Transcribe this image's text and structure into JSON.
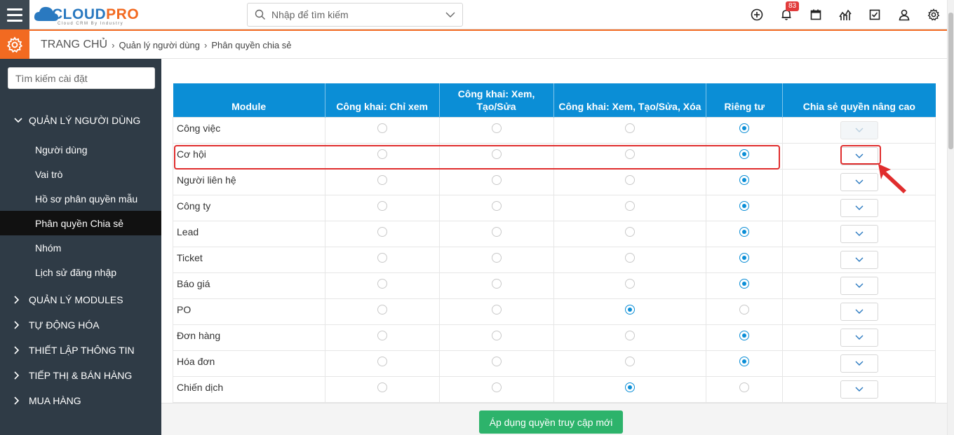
{
  "header": {
    "logo": {
      "brand_a": "CLOUD",
      "brand_b": "PRO",
      "tagline": "Cloud CRM By Industry"
    },
    "search": {
      "placeholder": "Nhập để tìm kiếm"
    },
    "notifications": {
      "count": "83"
    },
    "icons": [
      "add-circle-icon",
      "bell-icon",
      "calendar-icon",
      "chart-icon",
      "checkbox-icon",
      "user-icon",
      "gear-icon"
    ]
  },
  "breadcrumb": {
    "home": "TRANG CHỦ",
    "items": [
      "Quản lý người dùng",
      "Phân quyền chia sẻ"
    ]
  },
  "sidebar": {
    "search_placeholder": "Tìm kiếm cài đặt",
    "groups": [
      {
        "label": "QUẢN LÝ NGƯỜI DÙNG",
        "expanded": true
      },
      {
        "label": "QUẢN LÝ MODULES",
        "expanded": false
      },
      {
        "label": "TỰ ĐỘNG HÓA",
        "expanded": false
      },
      {
        "label": "THIẾT LẬP THÔNG TIN",
        "expanded": false
      },
      {
        "label": "TIẾP THỊ & BÁN HÀNG",
        "expanded": false
      },
      {
        "label": "MUA HÀNG",
        "expanded": false
      }
    ],
    "items": [
      {
        "label": "Người dùng",
        "active": false
      },
      {
        "label": "Vai trò",
        "active": false
      },
      {
        "label": "Hồ sơ phân quyền mẫu",
        "active": false
      },
      {
        "label": "Phân quyền Chia sẻ",
        "active": true
      },
      {
        "label": "Nhóm",
        "active": false
      },
      {
        "label": "Lịch sử đăng nhập",
        "active": false
      }
    ]
  },
  "table": {
    "columns": [
      "Module",
      "Công khai: Chỉ xem",
      "Công khai: Xem, Tạo/Sửa",
      "Công khai: Xem, Tạo/Sửa, Xóa",
      "Riêng tư",
      "Chia sẻ quyền nâng cao"
    ],
    "rows": [
      {
        "module": "Công việc",
        "selected": 4,
        "advanced_enabled": false
      },
      {
        "module": "Cơ hội",
        "selected": 4,
        "advanced_enabled": true
      },
      {
        "module": "Người liên hệ",
        "selected": 4,
        "advanced_enabled": true
      },
      {
        "module": "Công ty",
        "selected": 4,
        "advanced_enabled": true
      },
      {
        "module": "Lead",
        "selected": 4,
        "advanced_enabled": true
      },
      {
        "module": "Ticket",
        "selected": 4,
        "advanced_enabled": true
      },
      {
        "module": "Báo giá",
        "selected": 4,
        "advanced_enabled": true
      },
      {
        "module": "PO",
        "selected": 3,
        "advanced_enabled": true
      },
      {
        "module": "Đơn hàng",
        "selected": 4,
        "advanced_enabled": true
      },
      {
        "module": "Hóa đơn",
        "selected": 4,
        "advanced_enabled": true
      },
      {
        "module": "Chiến dịch",
        "selected": 3,
        "advanced_enabled": true
      }
    ]
  },
  "footer": {
    "apply_label": "Áp dụng quyền truy cập mới"
  },
  "colors": {
    "primary": "#0b8ed6",
    "accent": "#f26a21",
    "sidebar": "#2f3b46",
    "success": "#2db36b",
    "annotation": "#e02d2d"
  }
}
